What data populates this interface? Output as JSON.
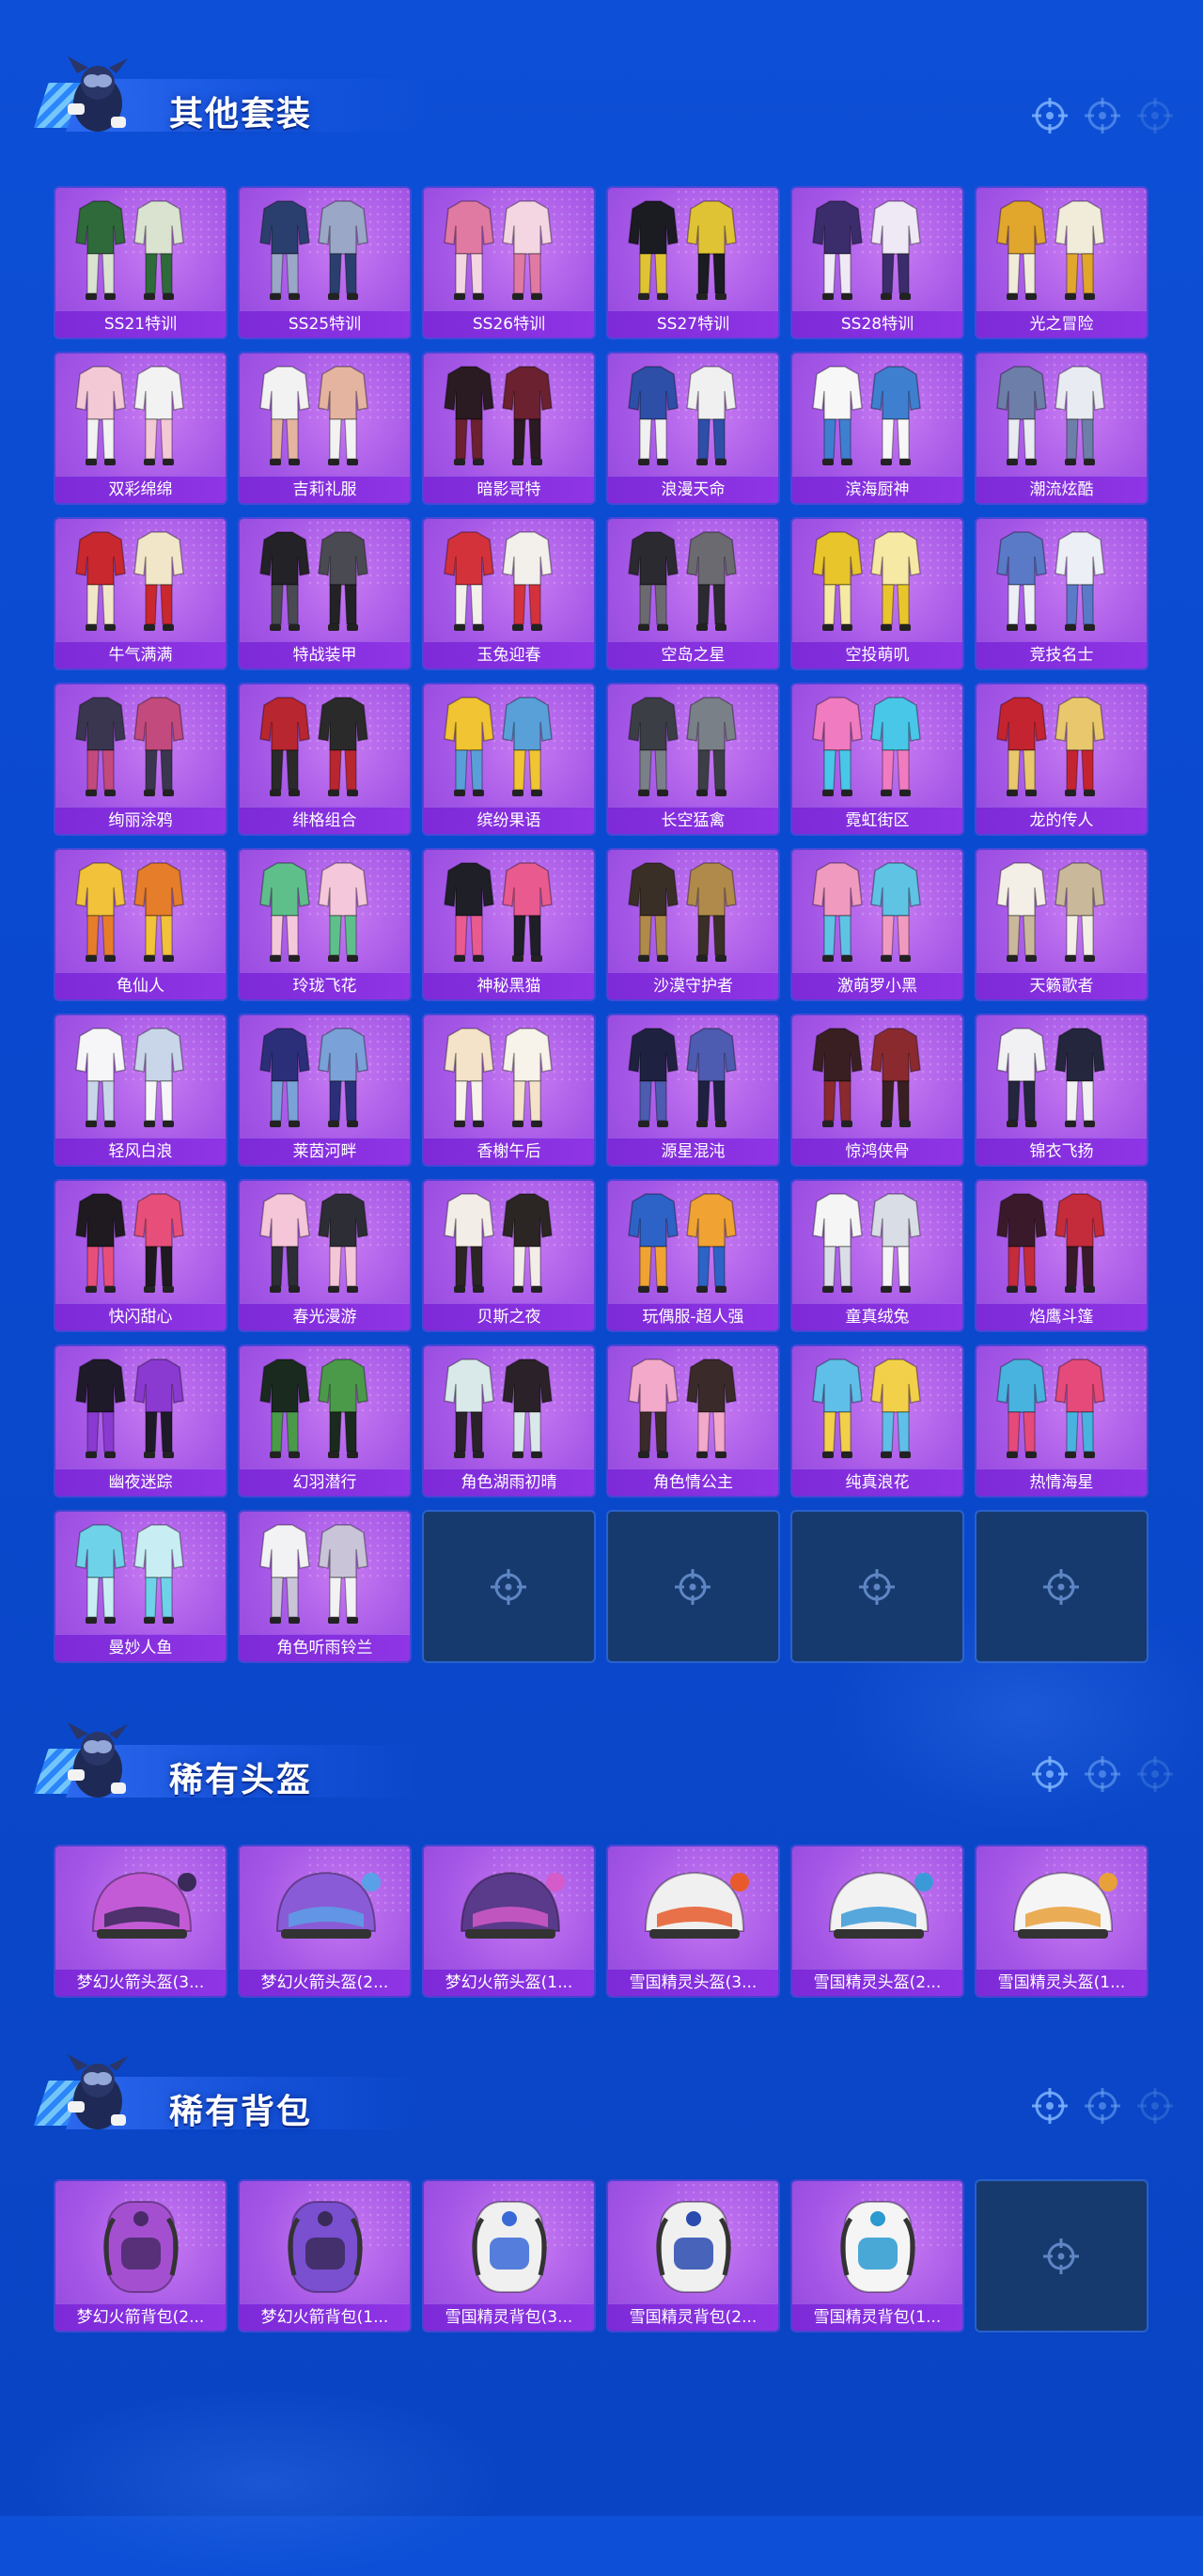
{
  "theme": {
    "accent": "#a456e6",
    "label_bg": "#7d2ad8",
    "empty_tile": "#173a6e",
    "background": "#0d4fd6"
  },
  "sections": {
    "suits": {
      "title": "其他套装",
      "items": [
        {
          "label": "SS21特训",
          "colors": [
            "#2f6b3a",
            "#d9e3d0"
          ]
        },
        {
          "label": "SS25特训",
          "colors": [
            "#2b3f6e",
            "#9aa7c7"
          ]
        },
        {
          "label": "SS26特训",
          "colors": [
            "#e17aa3",
            "#f4d6e3"
          ]
        },
        {
          "label": "SS27特训",
          "colors": [
            "#1b1b22",
            "#e0c334"
          ]
        },
        {
          "label": "SS28特训",
          "colors": [
            "#3b2d6b",
            "#efe9f5"
          ]
        },
        {
          "label": "光之冒险",
          "colors": [
            "#e1a62c",
            "#f1ecd9"
          ]
        },
        {
          "label": "双彩绵绵",
          "colors": [
            "#f3c9d6",
            "#f2f2f2"
          ]
        },
        {
          "label": "吉莉礼服",
          "colors": [
            "#f2f2f2",
            "#e5b4a0"
          ]
        },
        {
          "label": "暗影哥特",
          "colors": [
            "#2a1a22",
            "#6b2130"
          ]
        },
        {
          "label": "浪漫天命",
          "colors": [
            "#2d4fa8",
            "#f0f0f0"
          ]
        },
        {
          "label": "滨海厨神",
          "colors": [
            "#f7f7f7",
            "#3f7fd0"
          ]
        },
        {
          "label": "潮流炫酷",
          "colors": [
            "#6d7fa8",
            "#e8ebf2"
          ]
        },
        {
          "label": "牛气满满",
          "colors": [
            "#c9282e",
            "#f1e7c8"
          ]
        },
        {
          "label": "特战装甲",
          "colors": [
            "#222227",
            "#4a4b52"
          ]
        },
        {
          "label": "玉兔迎春",
          "colors": [
            "#d4323b",
            "#f3f0ec"
          ]
        },
        {
          "label": "空岛之星",
          "colors": [
            "#2a2a30",
            "#6a6a70"
          ]
        },
        {
          "label": "空投萌叽",
          "colors": [
            "#e8c52b",
            "#f6e9a3"
          ]
        },
        {
          "label": "竞技名士",
          "colors": [
            "#5a7ac8",
            "#eceff5"
          ]
        },
        {
          "label": "绚丽涂鸦",
          "colors": [
            "#3a3650",
            "#c24a7d"
          ]
        },
        {
          "label": "绯格组合",
          "colors": [
            "#b8262f",
            "#2a2a2a"
          ]
        },
        {
          "label": "缤纷果语",
          "colors": [
            "#f0c432",
            "#5aa0d8"
          ]
        },
        {
          "label": "长空猛禽",
          "colors": [
            "#3b3f45",
            "#7a8088"
          ]
        },
        {
          "label": "霓虹街区",
          "colors": [
            "#f07bc0",
            "#49c7e8"
          ]
        },
        {
          "label": "龙的传人",
          "colors": [
            "#c42430",
            "#e9c86d"
          ]
        },
        {
          "label": "龟仙人",
          "colors": [
            "#f1c23a",
            "#e57d2b"
          ]
        },
        {
          "label": "玲珑飞花",
          "colors": [
            "#5fbf8a",
            "#f4c8da"
          ]
        },
        {
          "label": "神秘黑猫",
          "colors": [
            "#1f1f28",
            "#e95b8f"
          ]
        },
        {
          "label": "沙漠守护者",
          "colors": [
            "#3a2f26",
            "#b08a4a"
          ]
        },
        {
          "label": "激萌罗小黑",
          "colors": [
            "#f19ac0",
            "#5fc3e4"
          ]
        },
        {
          "label": "天籁歌者",
          "colors": [
            "#f3efe6",
            "#c9b99a"
          ]
        },
        {
          "label": "轻风白浪",
          "colors": [
            "#f6f6f8",
            "#c9d6ea"
          ]
        },
        {
          "label": "莱茵河畔",
          "colors": [
            "#2b2f7a",
            "#7aa2d8"
          ]
        },
        {
          "label": "香榭午后",
          "colors": [
            "#f4e3c9",
            "#f7f2ea"
          ]
        },
        {
          "label": "源星混沌",
          "colors": [
            "#1f2140",
            "#4d5bb0"
          ]
        },
        {
          "label": "惊鸿侠骨",
          "colors": [
            "#3a1f22",
            "#8a2a2f"
          ]
        },
        {
          "label": "锦衣飞扬",
          "colors": [
            "#f1f1f4",
            "#23263c"
          ]
        },
        {
          "label": "快闪甜心",
          "colors": [
            "#1f1a20",
            "#e74f7a"
          ]
        },
        {
          "label": "春光漫游",
          "colors": [
            "#f4c6d8",
            "#2d2d35"
          ]
        },
        {
          "label": "贝斯之夜",
          "colors": [
            "#f3ede7",
            "#2b2524"
          ]
        },
        {
          "label": "玩偶服-超人强",
          "colors": [
            "#2d63c6",
            "#f0a333"
          ]
        },
        {
          "label": "童真绒兔",
          "colors": [
            "#f5f5f5",
            "#d9dde6"
          ]
        },
        {
          "label": "焰鹰斗篷",
          "colors": [
            "#3a1a2a",
            "#c42b3b"
          ]
        },
        {
          "label": "幽夜迷踪",
          "colors": [
            "#1f1a2a",
            "#8a3ad0"
          ]
        },
        {
          "label": "幻羽潜行",
          "colors": [
            "#1a2a1f",
            "#4a9a4a"
          ]
        },
        {
          "label": "角色湖雨初晴",
          "colors": [
            "#d9e9ea",
            "#2a2228"
          ]
        },
        {
          "label": "角色情公主",
          "colors": [
            "#f3a9c9",
            "#3a2a2a"
          ]
        },
        {
          "label": "纯真浪花",
          "colors": [
            "#5fbfe8",
            "#f3d04a"
          ]
        },
        {
          "label": "热情海星",
          "colors": [
            "#49b3e0",
            "#e54a7a"
          ]
        },
        {
          "label": "曼妙人鱼",
          "colors": [
            "#6ed3e8",
            "#c8eef3"
          ]
        },
        {
          "label": "角色听雨铃兰",
          "colors": [
            "#f2f2f4",
            "#c9c4d8"
          ]
        }
      ],
      "empty_slots": 4
    },
    "helmets": {
      "title": "稀有头盔",
      "items": [
        {
          "label": "梦幻火箭头盔(3...",
          "colors": [
            "#c45bd6",
            "#3a2a5a"
          ]
        },
        {
          "label": "梦幻火箭头盔(2...",
          "colors": [
            "#8a5bd6",
            "#5aa0e8"
          ]
        },
        {
          "label": "梦幻火箭头盔(1...",
          "colors": [
            "#5a3a8a",
            "#d45bc9"
          ]
        },
        {
          "label": "雪国精灵头盔(3...",
          "colors": [
            "#f0f0f0",
            "#e85a2b"
          ]
        },
        {
          "label": "雪国精灵头盔(2...",
          "colors": [
            "#f2f2f2",
            "#3a9ad8"
          ]
        },
        {
          "label": "雪国精灵头盔(1...",
          "colors": [
            "#f5f5f5",
            "#e8a03a"
          ]
        }
      ],
      "empty_slots": 0
    },
    "backpacks": {
      "title": "稀有背包",
      "items": [
        {
          "label": "梦幻火箭背包(2...",
          "colors": [
            "#a44fd0",
            "#4a2a6a"
          ]
        },
        {
          "label": "梦幻火箭背包(1...",
          "colors": [
            "#7a4fd0",
            "#3a2a5a"
          ]
        },
        {
          "label": "雪国精灵背包(3...",
          "colors": [
            "#f0f0f0",
            "#3a6ad8"
          ]
        },
        {
          "label": "雪国精灵背包(2...",
          "colors": [
            "#f0f0f0",
            "#2a4ab0"
          ]
        },
        {
          "label": "雪国精灵背包(1...",
          "colors": [
            "#f5f5f5",
            "#2a9ad0"
          ]
        }
      ],
      "empty_slots": 1
    }
  }
}
